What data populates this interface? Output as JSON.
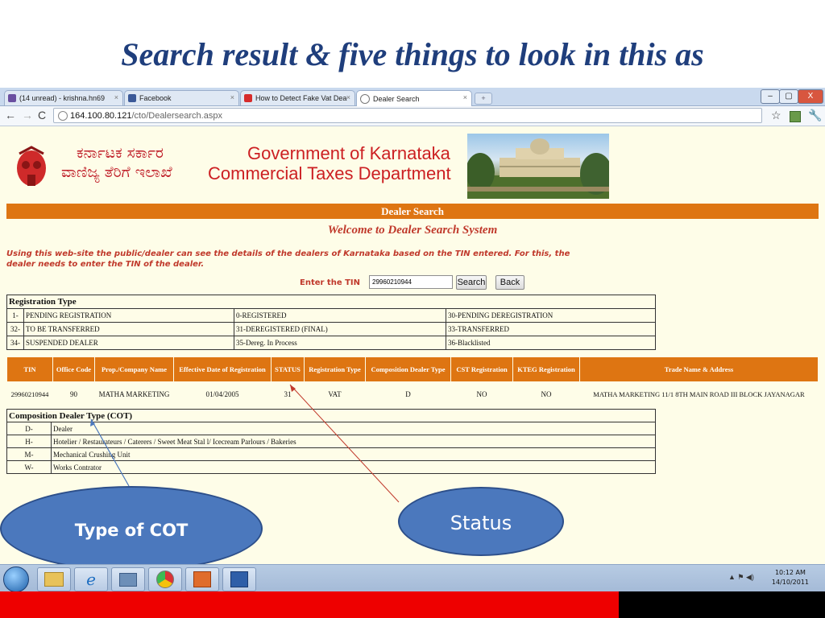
{
  "slide": {
    "title": "Search result & five things to look in this as"
  },
  "browser": {
    "tabs": [
      {
        "label": "(14 unread) - krishna.hn69",
        "icon": "mail-icon"
      },
      {
        "label": "Facebook",
        "icon": "facebook-icon"
      },
      {
        "label": "How to Detect Fake Vat Dea",
        "icon": "youtube-icon"
      },
      {
        "label": "Dealer Search",
        "icon": "page-icon"
      }
    ],
    "url_host": "164.100.80.121",
    "url_path": "/cto/Dealersearch.aspx",
    "window_buttons": [
      "–",
      "▢",
      "X"
    ]
  },
  "page": {
    "kannada_line1": "ಕರ್ನಾಟಕ ಸರ್ಕಾರ",
    "kannada_line2": "ವಾಣಿಜ್ಯ ತೆರಿಗೆ ಇಲಾಖೆ",
    "gov_line1": "Government of Karnataka",
    "gov_line2": "Commercial Taxes Department",
    "bar_title": "Dealer Search",
    "welcome": "Welcome to Dealer Search System",
    "intro": "Using this web-site the public/dealer can see the details of the dealers of Karnataka based on the TIN entered. For this, the dealer needs to enter the TIN of the dealer.",
    "tin_label": "Enter the TIN",
    "tin_value": "29960210944",
    "search_button": "Search",
    "back_button": "Back"
  },
  "registration_type": {
    "header": "Registration Type",
    "rows": [
      [
        "1-",
        "PENDING REGISTRATION",
        "0-REGISTERED",
        "30-PENDING DEREGISTRATION"
      ],
      [
        "32-",
        "TO BE TRANSFERRED",
        "31-DEREGISTERED (FINAL)",
        "33-TRANSFERRED"
      ],
      [
        "34-",
        "SUSPENDED DEALER",
        "35-Dereg. In Process",
        "36-Blacklisted"
      ]
    ]
  },
  "result": {
    "headers": [
      "TIN",
      "Office Code",
      "Prop./Company Name",
      "Effective Date of Registration",
      "STATUS",
      "Registration Type",
      "Composition Dealer Type",
      "CST Registration",
      "KTEG Registration",
      "Trade Name & Address"
    ],
    "row": [
      "29960210944",
      "90",
      "MATHA MARKETING",
      "01/04/2005",
      "31",
      "VAT",
      "D",
      "NO",
      "NO",
      "MATHA MARKETING 11/1 8TH MAIN ROAD III BLOCK JAYANAGAR"
    ]
  },
  "cot": {
    "header": "Composition Dealer Type (COT)",
    "rows": [
      [
        "D-",
        "Dealer"
      ],
      [
        "H-",
        "Hotelier / Restaurateurs / Caterers / Sweet Meat Stal l/ Icecream Parlours / Bakeries"
      ],
      [
        "M-",
        "Mechanical Crushing Unit"
      ],
      [
        "W-",
        "Works Contrator"
      ]
    ]
  },
  "callouts": {
    "cot": "Type of COT",
    "status": "Status"
  },
  "taskbar": {
    "time": "10:12 AM",
    "date": "14/10/2011"
  },
  "colors": {
    "title_blue": "#1f3e7c",
    "orange": "#de7512",
    "page_bg": "#fefde8",
    "callout_blue": "#4b78bd",
    "bottom_red": "#ee0000"
  }
}
